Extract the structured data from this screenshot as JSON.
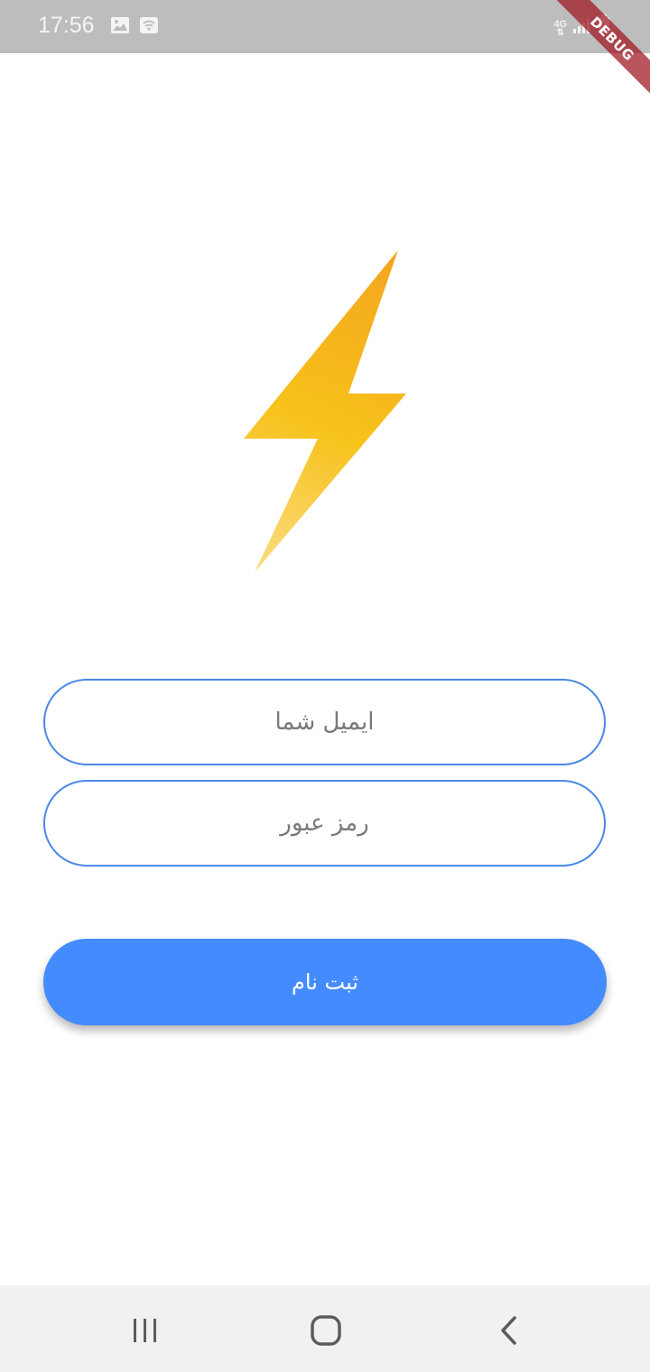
{
  "status_bar": {
    "time": "17:56",
    "network_label": "4G",
    "icons": [
      "image-icon",
      "wifi-icon",
      "signal-icon",
      "battery-icon"
    ]
  },
  "debug_banner": "DEBUG",
  "logo": {
    "icon": "lightning-bolt-icon",
    "colors": [
      "#f4a51f",
      "#f7c21a",
      "#fbdc84"
    ]
  },
  "form": {
    "email_placeholder": "ایمیل شما",
    "password_placeholder": "رمز عبور",
    "submit_label": "ثبت نام"
  },
  "nav_bar": {
    "icons": [
      "recent-apps-icon",
      "home-icon",
      "back-icon"
    ]
  },
  "colors": {
    "accent": "#448bff",
    "field_border": "#4a89e5",
    "status_bar": "#bdbdbd",
    "nav_bar": "#f1f1f1"
  }
}
